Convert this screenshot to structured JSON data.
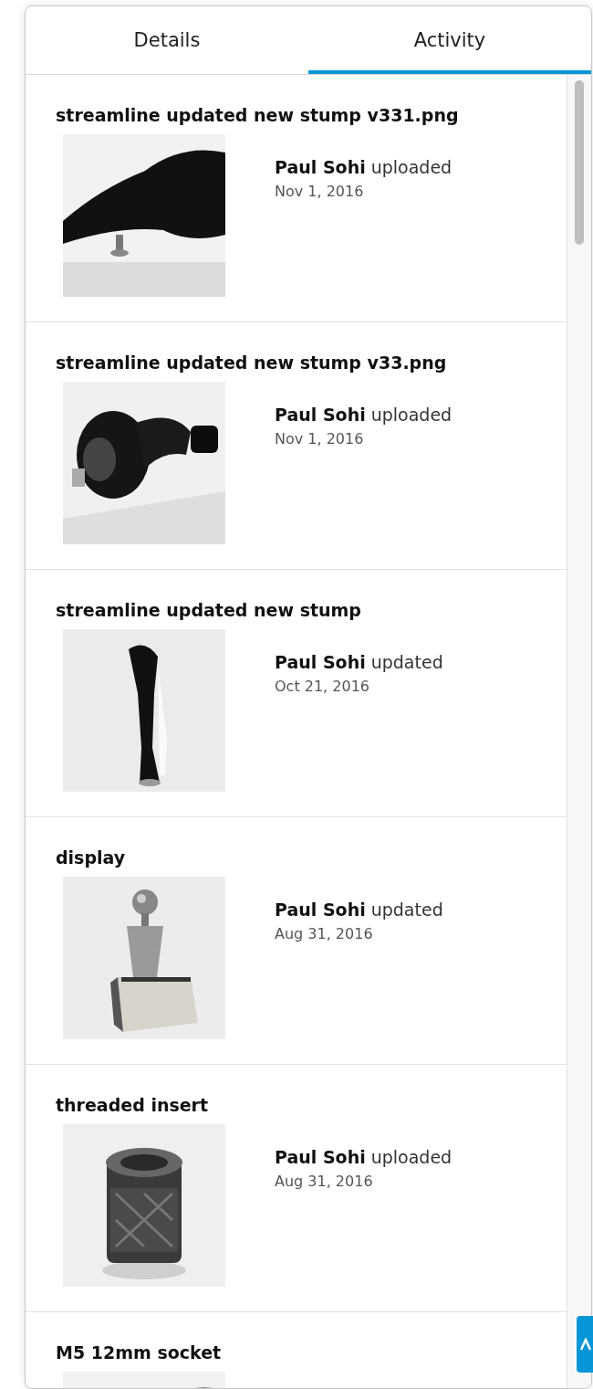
{
  "tabs": [
    {
      "label": "Details",
      "selected": false
    },
    {
      "label": "Activity",
      "selected": true
    }
  ],
  "activity": [
    {
      "title": "streamline updated new stump v331.png",
      "user": "Paul Sohi",
      "action": "uploaded",
      "date": "Nov 1, 2016"
    },
    {
      "title": "streamline updated new stump v33.png",
      "user": "Paul Sohi",
      "action": "uploaded",
      "date": "Nov 1, 2016"
    },
    {
      "title": "streamline updated new stump",
      "user": "Paul Sohi",
      "action": "updated",
      "date": "Oct 21, 2016"
    },
    {
      "title": "display",
      "user": "Paul Sohi",
      "action": "updated",
      "date": "Aug 31, 2016"
    },
    {
      "title": "threaded insert",
      "user": "Paul Sohi",
      "action": "uploaded",
      "date": "Aug 31, 2016"
    },
    {
      "title": "M5 12mm socket"
    }
  ]
}
